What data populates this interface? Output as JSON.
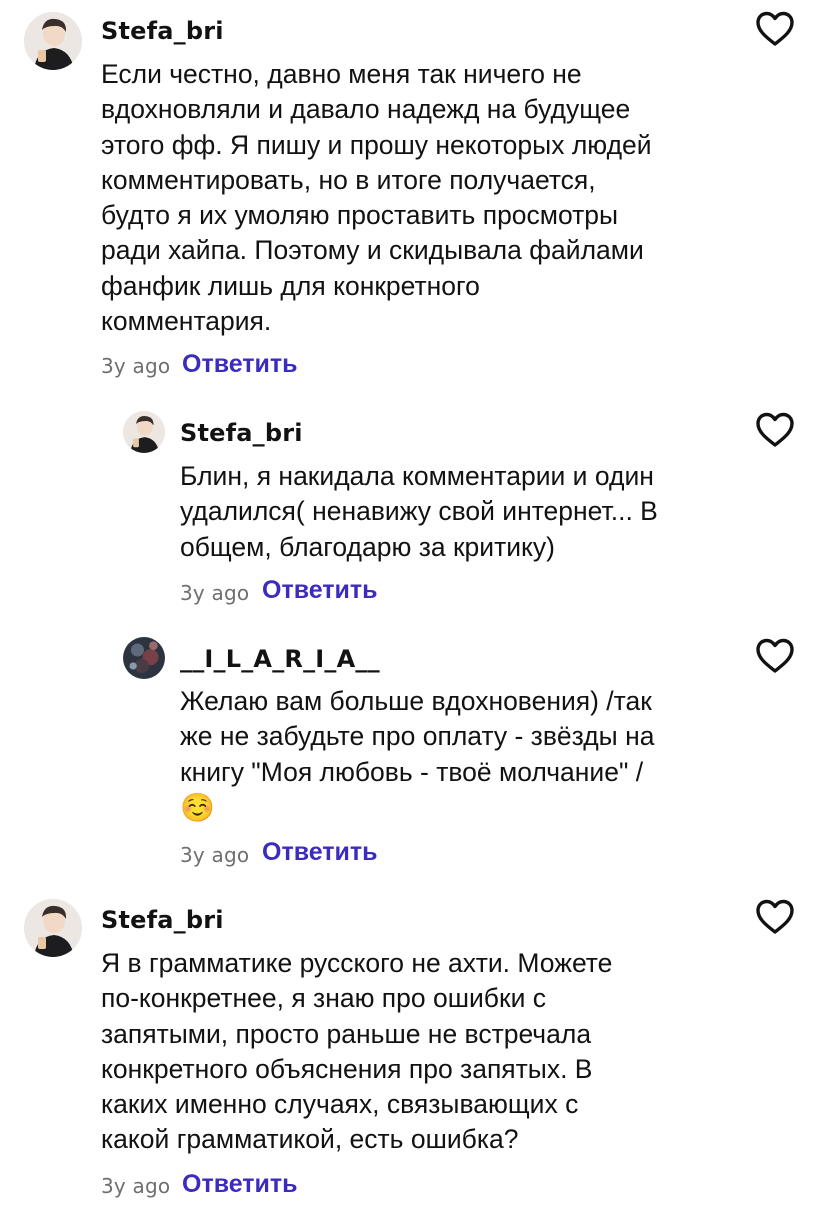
{
  "comments": [
    {
      "username": "Stefa_bri",
      "avatar_icon": "user-avatar-photo",
      "text": "Если честно, давно меня так ничего не\nвдохновляли и давало надежд на будущее\nэтого фф. Я пишу и прошу некоторых людей\nкомментировать, но в итоге получается,\nбудто я их умоляю проставить просмотры\nради хайпа. Поэтому и скидывала файлами\nфанфик лишь для конкретного\nкомментария.",
      "time": "3y ago",
      "reply_label": "Ответить",
      "like_icon": "heart-outline-icon"
    },
    {
      "username": "Stefa_bri",
      "avatar_icon": "user-avatar-photo",
      "text": "Блин, я накидала комментарии и один\nудалился( ненавижу свой интернет... В\nобщем, благодарю за критику)",
      "time": "3y ago",
      "reply_label": "Ответить",
      "like_icon": "heart-outline-icon"
    },
    {
      "username": "__I_L_A_R_I_A__",
      "avatar_icon": "user-avatar-photo-dark",
      "text": "Желаю вам больше вдохновения) /так\nже не забудьте про оплату - звёзды на\nкнигу \"Моя любовь  - твоё молчание\" /",
      "emoji": "☺️",
      "time": "3y ago",
      "reply_label": "Ответить",
      "like_icon": "heart-outline-icon"
    },
    {
      "username": "Stefa_bri",
      "avatar_icon": "user-avatar-photo",
      "text": "Я в грамматике русского не ахти. Можете\nпо-конкретнее, я знаю про ошибки с\nзапятыми, просто раньше не встречала\nконкретного объяснения про запятых. В\nкаких именно случаях, связывающих с\nкакой грамматикой, есть ошибка?",
      "time": "3y ago",
      "reply_label": "Ответить",
      "like_icon": "heart-outline-icon"
    }
  ],
  "colors": {
    "reply_link": "#3b2bbf",
    "timestamp": "#6f6f6f",
    "text": "#121212"
  }
}
